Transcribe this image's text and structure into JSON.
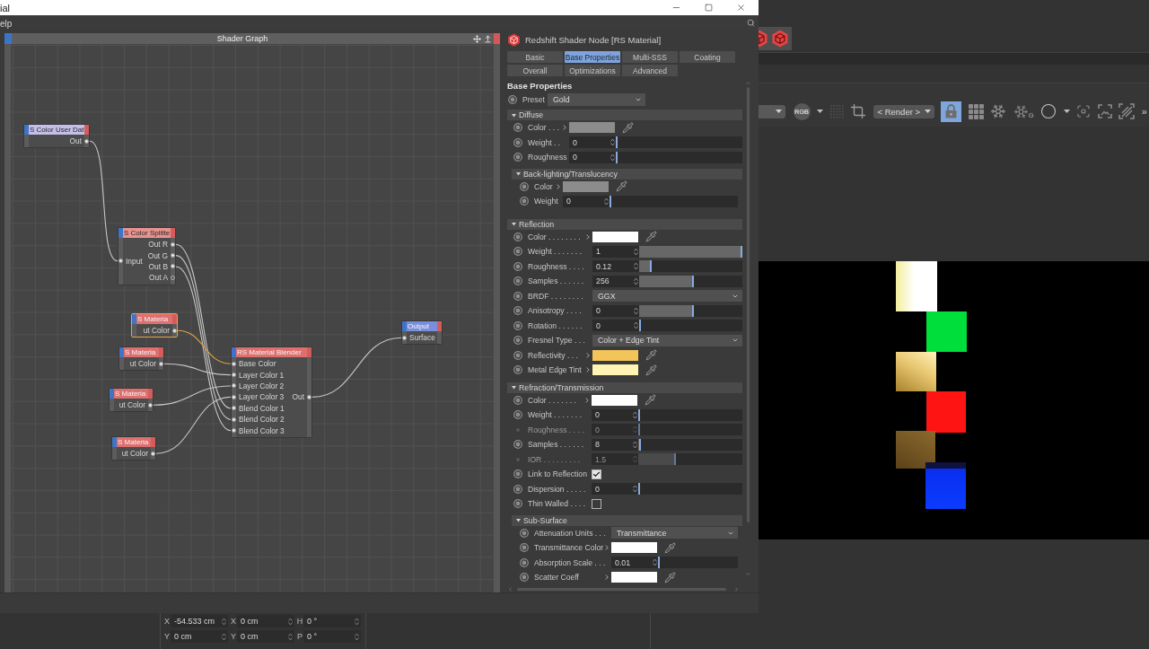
{
  "window": {
    "title": "ial",
    "menu": [
      {
        "label": "elp"
      }
    ]
  },
  "shader_graph": {
    "title": "Shader Graph",
    "nodes": [
      {
        "title": "S Color User Dat",
        "color": "#c4bfe8",
        "selected": false,
        "outputs": [
          {
            "label": "Out",
            "connected": true
          }
        ]
      },
      {
        "title": "S Color Splitte",
        "color": "#e79390",
        "selected": false,
        "inputs": [
          {
            "label": "Input",
            "connected": true
          }
        ],
        "outputs": [
          {
            "label": "Out R",
            "connected": true
          },
          {
            "label": "Out G",
            "connected": true
          },
          {
            "label": "Out B",
            "connected": true
          },
          {
            "label": "Out A",
            "connected": false
          }
        ]
      },
      {
        "title": "S Materia",
        "color": "#dd6f6f",
        "selected": true,
        "outputs": [
          {
            "label": "ut Color",
            "connected": true
          }
        ]
      },
      {
        "title": "S Materia",
        "color": "#dd6f6f",
        "selected": false,
        "outputs": [
          {
            "label": "ut Color",
            "connected": true
          }
        ]
      },
      {
        "title": "S Materia",
        "color": "#dd6f6f",
        "selected": false,
        "outputs": [
          {
            "label": "ut Color",
            "connected": true
          }
        ]
      },
      {
        "title": "S Materia",
        "color": "#dd6f6f",
        "selected": false,
        "outputs": [
          {
            "label": "ut Color",
            "connected": true
          }
        ]
      },
      {
        "title": "RS Material Blender",
        "color": "#dd6f6f",
        "selected": false,
        "inputs": [
          {
            "label": "Base Color",
            "connected": true
          },
          {
            "label": "Layer Color 1",
            "connected": true
          },
          {
            "label": "Layer Color 2",
            "connected": true
          },
          {
            "label": "Layer Color 3",
            "connected": true
          },
          {
            "label": "Blend Color 1",
            "connected": true
          },
          {
            "label": "Blend Color 2",
            "connected": true
          },
          {
            "label": "Blend Color 3",
            "connected": true
          }
        ],
        "outputs": [
          {
            "label": "Out",
            "connected": true
          }
        ]
      },
      {
        "title": "Output",
        "color": "#7a8fdc",
        "selected": false,
        "inputs": [
          {
            "label": "Surface",
            "connected": true
          }
        ]
      }
    ]
  },
  "properties": {
    "node_title": "Redshift Shader Node [RS Material]",
    "tabs": [
      {
        "label": "Basic",
        "selected": false
      },
      {
        "label": "Base Properties",
        "selected": true
      },
      {
        "label": "Multi-SSS",
        "selected": false
      },
      {
        "label": "Coating",
        "selected": false
      },
      {
        "label": "Overall",
        "selected": false
      },
      {
        "label": "Optimizations",
        "selected": false
      },
      {
        "label": "Advanced",
        "selected": false
      }
    ],
    "heading": "Base Properties",
    "preset": {
      "label": "Preset",
      "value": "Gold"
    },
    "sections": [
      {
        "title": "Diffuse",
        "expanded": true,
        "rows": [
          {
            "kind": "color",
            "label": "Color . . .",
            "color": "#8c8c8c",
            "disabled": false
          },
          {
            "kind": "number",
            "label": "Weight . .",
            "value": "0",
            "level": 0,
            "disabled": false
          },
          {
            "kind": "number",
            "label": "Roughness",
            "value": "0",
            "level": 0,
            "disabled": false
          }
        ],
        "children": [
          {
            "title": "Back-lighting/Translucency",
            "expanded": true,
            "rows": [
              {
                "kind": "color",
                "label": "Color",
                "color": "#8c8c8c",
                "disabled": false
              },
              {
                "kind": "number",
                "label": "Weight",
                "value": "0",
                "level": 0,
                "disabled": false
              }
            ]
          }
        ]
      },
      {
        "title": "Reflection",
        "expanded": true,
        "rows": [
          {
            "kind": "color",
            "label": "Color . . . . . . . .",
            "color": "#ffffff",
            "disabled": false
          },
          {
            "kind": "number",
            "label": "Weight . . . . . . .",
            "value": "1",
            "level": 1,
            "disabled": false
          },
          {
            "kind": "number",
            "label": "Roughness . . . .",
            "value": "0.12",
            "level": 0.11,
            "disabled": false
          },
          {
            "kind": "number",
            "label": "Samples . . . . . .",
            "value": "256",
            "level": 0.52,
            "disabled": false
          },
          {
            "kind": "dropdown",
            "label": "BRDF . . . . . . . .",
            "value": "GGX",
            "disabled": false
          },
          {
            "kind": "number",
            "label": "Anisotropy . . . .",
            "value": "0",
            "level": 0.52,
            "disabled": false
          },
          {
            "kind": "number",
            "label": "Rotation . . . . . .",
            "value": "0",
            "level": 0,
            "disabled": false
          },
          {
            "kind": "dropdown",
            "label": "Fresnel Type . . .",
            "value": "Color + Edge Tint",
            "disabled": false
          },
          {
            "kind": "color",
            "label": "Reflectivity . . .",
            "color": "#f2c45a",
            "disabled": false
          },
          {
            "kind": "color",
            "label": "Metal Edge Tint",
            "color": "#fff4b4",
            "disabled": false
          }
        ]
      },
      {
        "title": "Refraction/Transmission",
        "expanded": true,
        "rows": [
          {
            "kind": "color",
            "label": "Color . . . . . . .",
            "color": "#ffffff",
            "disabled": false
          },
          {
            "kind": "number",
            "label": "Weight . . . . . . .",
            "value": "0",
            "level": 0,
            "disabled": false
          },
          {
            "kind": "number",
            "label": "Roughness . . . .",
            "value": "0",
            "level": 0,
            "disabled": true
          },
          {
            "kind": "number",
            "label": "Samples . . . . . .",
            "value": "8",
            "level": 0.01,
            "disabled": false
          },
          {
            "kind": "number",
            "label": "IOR . . . . . . . . .",
            "value": "1.5",
            "level": 0.35,
            "disabled": true
          },
          {
            "kind": "checkbox",
            "label": "Link to Reflection",
            "checked": true,
            "disabled": false
          },
          {
            "kind": "number",
            "label": "Dispersion . . . . .",
            "value": "0",
            "level": 0,
            "disabled": false
          },
          {
            "kind": "checkbox",
            "label": "Thin Walled . . . .",
            "checked": false,
            "disabled": false
          }
        ],
        "children": [
          {
            "title": "Sub-Surface",
            "expanded": true,
            "rows": [
              {
                "kind": "dropdown",
                "label": "Attenuation Units . . .",
                "value": "Transmittance",
                "disabled": false
              },
              {
                "kind": "color",
                "label": "Transmittance Color",
                "color": "#ffffff",
                "disabled": false
              },
              {
                "kind": "number",
                "label": "Absorption Scale . . .",
                "value": "0.01",
                "level": 0,
                "disabled": false
              },
              {
                "kind": "color",
                "label": "Scatter Coeff",
                "color": "#ffffff",
                "disabled": false
              }
            ]
          }
        ]
      }
    ]
  },
  "viewer_toolbar": {
    "color_mode": "RGB",
    "display": "< Render >",
    "lock": {
      "on": true
    },
    "snowflake_letter": "G",
    "more": "»"
  },
  "coordinates": {
    "rows": [
      {
        "fields": [
          {
            "axis": "X",
            "value": "-54.533 cm"
          },
          {
            "axis": "X",
            "value": "0 cm"
          },
          {
            "axis": "H",
            "value": "0 °"
          }
        ]
      },
      {
        "fields": [
          {
            "axis": "Y",
            "value": "0 cm"
          },
          {
            "axis": "Y",
            "value": "0 cm"
          },
          {
            "axis": "P",
            "value": "0 °"
          }
        ]
      }
    ]
  }
}
